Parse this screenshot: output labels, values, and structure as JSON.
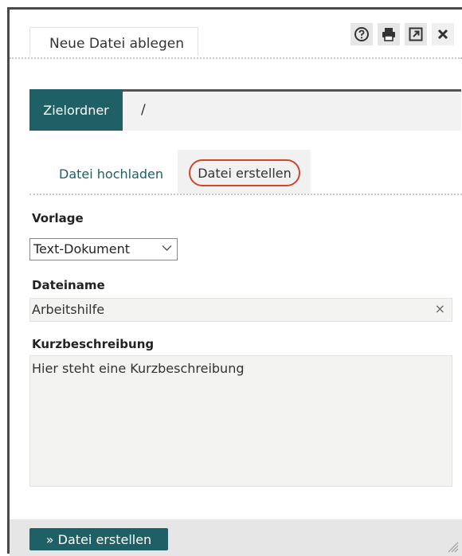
{
  "dialog": {
    "title": "Neue Datei ablegen",
    "icons": [
      "help-icon",
      "print-icon",
      "popout-icon",
      "close-icon"
    ]
  },
  "folder": {
    "label": "Zielordner",
    "path": "/"
  },
  "tabs": {
    "upload": "Datei hochladen",
    "create": "Datei erstellen",
    "active": "create"
  },
  "form": {
    "template_label": "Vorlage",
    "template_value": "Text-Dokument",
    "filename_label": "Dateiname",
    "filename_value": "Arbeitshilfe",
    "description_label": "Kurzbeschreibung",
    "description_value": "Hier steht eine Kurzbeschreibung"
  },
  "footer": {
    "submit_label": "» Datei erstellen"
  },
  "colors": {
    "accent": "#1f5f66",
    "highlight": "#d0462c"
  }
}
